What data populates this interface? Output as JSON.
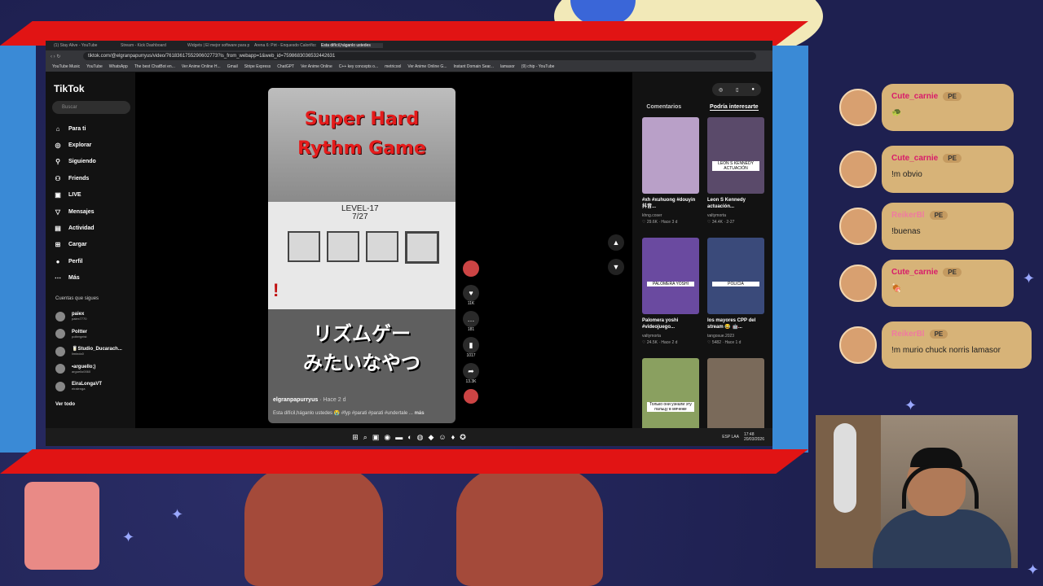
{
  "browser": {
    "tabs": [
      "(1) Stay Alive - YouTube",
      "Stream - Kick Dashboard",
      "Widgets | El mejor software para p...",
      "Arena 6: Pirt - Enquesdo Calorifico...",
      "Esta difícil,háganlo ustedes"
    ],
    "url": "tiktok.com/@elgranpapurryus/video/7618361755290602773?is_from_webapp=1&web_id=7598683036532442631",
    "bookmarks": [
      "YouTube Music",
      "YouTube",
      "WhatsApp",
      "The best ChatBot en...",
      "Ver Anime Online H...",
      "Gmail",
      "Stripe Express",
      "ChatGPT",
      "Ver Anime Online",
      "C++ key concepts o...",
      "metricool",
      "Ver Anime Online G...",
      "Instant Domain Sear...",
      "lamasor",
      "(9) chip - YouTube"
    ]
  },
  "tiktok": {
    "logo": "TikTok",
    "search_placeholder": "Buscar",
    "nav": [
      {
        "label": "Para ti",
        "icon": "home-icon",
        "glyph": "⌂"
      },
      {
        "label": "Explorar",
        "icon": "compass-icon",
        "glyph": "◎"
      },
      {
        "label": "Siguiendo",
        "icon": "following-icon",
        "glyph": "⚲"
      },
      {
        "label": "Friends",
        "icon": "friends-icon",
        "glyph": "⚇"
      },
      {
        "label": "LIVE",
        "icon": "live-icon",
        "glyph": "▣"
      },
      {
        "label": "Mensajes",
        "icon": "messages-icon",
        "glyph": "▽"
      },
      {
        "label": "Actividad",
        "icon": "activity-icon",
        "glyph": "▤"
      },
      {
        "label": "Cargar",
        "icon": "upload-icon",
        "glyph": "⊞"
      },
      {
        "label": "Perfil",
        "icon": "profile-icon",
        "glyph": "●"
      },
      {
        "label": "Más",
        "icon": "more-icon",
        "glyph": "⋯"
      }
    ],
    "following_header": "Cuentas que sigues",
    "following": [
      {
        "name": "paiex",
        "user": "paiex7770"
      },
      {
        "name": "Poltter",
        "user": "poltergeist"
      },
      {
        "name": "🥛Studio_Ducarach...",
        "user": "limindo0"
      },
      {
        "name": "•arguello;)",
        "user": "arguello0060"
      },
      {
        "name": "EiraLongaVT",
        "user": "eiralenga"
      }
    ],
    "see_all": "Ver todo",
    "video": {
      "title_line1": "Super Hard",
      "title_line2": "Rythm Game",
      "level_line1": "LEVEL-17",
      "level_line2": "7/27",
      "jp_line1": "リズムゲー",
      "jp_line2": "みたいなやつ",
      "author": "elgranpapurryus",
      "time": "· Hace 2 d",
      "description": "Esta difícil,háganlo ustedes 😭 #fyp #parati #parati #undertale ...",
      "more": "más"
    },
    "actions": [
      {
        "icon": "heart-icon",
        "glyph": "♥",
        "count": "11K"
      },
      {
        "icon": "comment-icon",
        "glyph": "…",
        "count": "181"
      },
      {
        "icon": "bookmark-icon",
        "glyph": "▮",
        "count": "1017"
      },
      {
        "icon": "share-icon",
        "glyph": "➦",
        "count": "13.3K"
      }
    ],
    "panel_tabs": [
      "Comentarios",
      "Podría interesarte"
    ],
    "suggestions": [
      {
        "title": "#xh #xuhuong #douyin抖音...",
        "user": "khng.coser",
        "stats": "♡ 29.6K · Hace 3 d",
        "color": "#b9a0c8"
      },
      {
        "title": "Leon S Kennedy actuación...",
        "user": "valtymorta",
        "stats": "♡ 34.4K · 2-27",
        "color": "#5a4a6a",
        "overlay": "LEON S KENNEDY ACTUACIÓN"
      },
      {
        "title": "Palomera yoshi #videojuego...",
        "user": "valtymorta",
        "stats": "♡ 24.5K · Hace 2 d",
        "color": "#6a4aa0",
        "overlay": "PALOMERA YOSHI"
      },
      {
        "title": "los mayores CPP del stream 😂 🤖...",
        "user": "tangosue.2023",
        "stats": "♡ 5482 · Hace 1 d",
        "color": "#3a4a7a",
        "overlay": "POLICIA"
      },
      {
        "title": "",
        "user": "",
        "stats": "",
        "color": "#8aa060",
        "overlay": "Только они узнали эту пальцу в мячеже"
      },
      {
        "title": "",
        "user": "",
        "stats": "",
        "color": "#7a6a5a"
      }
    ]
  },
  "taskbar": {
    "tray_lang": "ESP LAA",
    "time": "17:48",
    "date": "20/03/2026"
  },
  "chat": [
    {
      "user": "Cute_carnie",
      "badge": "PE",
      "text": "🐢",
      "dark": false
    },
    {
      "user": "Cute_carnie",
      "badge": "PE",
      "text": "!m obvio",
      "dark": false
    },
    {
      "user": "ReikerBl",
      "badge": "PE",
      "text": "!buenas",
      "dark": true
    },
    {
      "user": "Cute_carnie",
      "badge": "PE",
      "text": "🍖",
      "dark": false
    },
    {
      "user": "ReikerBl",
      "badge": "PE",
      "text": "!m murio chuck norris lamasor",
      "dark": true
    }
  ]
}
